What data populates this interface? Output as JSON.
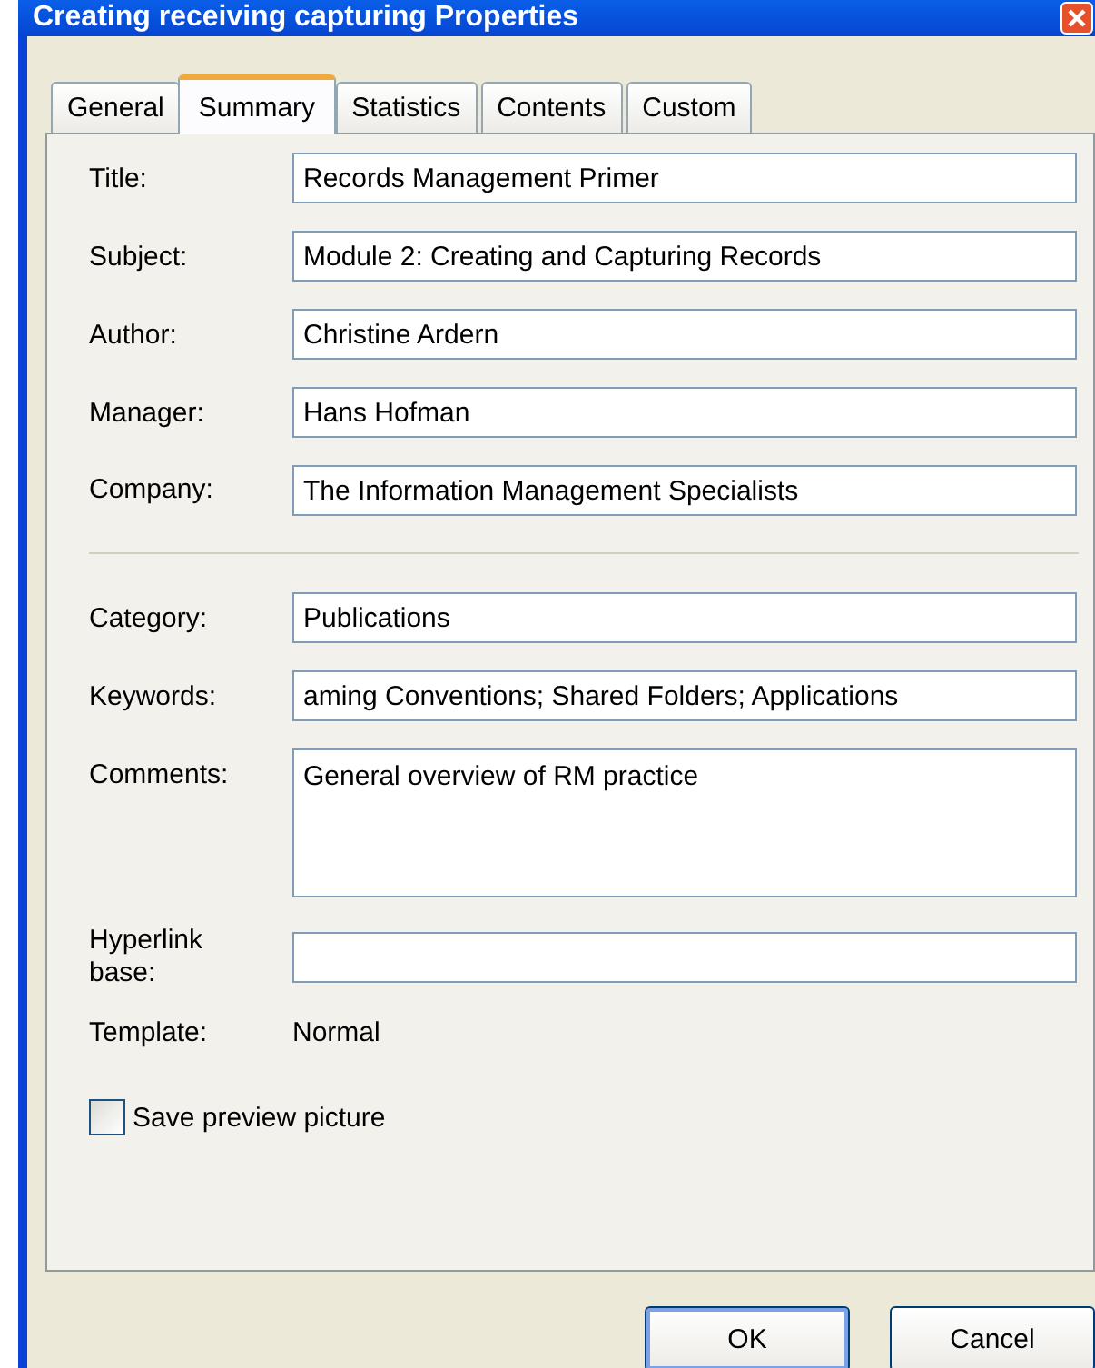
{
  "window": {
    "title": "Creating receiving capturing Properties"
  },
  "tabs": [
    {
      "label": "General",
      "selected": false
    },
    {
      "label": "Summary",
      "selected": true
    },
    {
      "label": "Statistics",
      "selected": false
    },
    {
      "label": "Contents",
      "selected": false
    },
    {
      "label": "Custom",
      "selected": false
    }
  ],
  "groups": [
    {
      "fields": [
        {
          "label": "Title:",
          "value": "Records Management Primer",
          "kind": "text"
        },
        {
          "label": "Subject:",
          "value": "Module 2: Creating and Capturing Records",
          "kind": "text"
        },
        {
          "label": "Author:",
          "value": "Christine Ardern",
          "kind": "text"
        },
        {
          "label": "Manager:",
          "value": "Hans Hofman",
          "kind": "text"
        },
        {
          "label": "Company:",
          "value": "The Information Management Specialists",
          "kind": "text"
        }
      ]
    },
    {
      "fields": [
        {
          "label": "Category:",
          "value": "Publications",
          "kind": "text"
        },
        {
          "label": "Keywords:",
          "value": "aming Conventions; Shared Folders; Applications",
          "kind": "text"
        },
        {
          "label": "Comments:",
          "value": "General overview of RM practice",
          "kind": "textarea"
        },
        {
          "label": "Hyperlink base:",
          "kind": "text"
        }
      ]
    }
  ],
  "template": {
    "label": "Template:",
    "value": "Normal"
  },
  "save_preview": {
    "label": "Save preview picture",
    "checked": false
  },
  "buttons": [
    "OK",
    "Cancel"
  ]
}
